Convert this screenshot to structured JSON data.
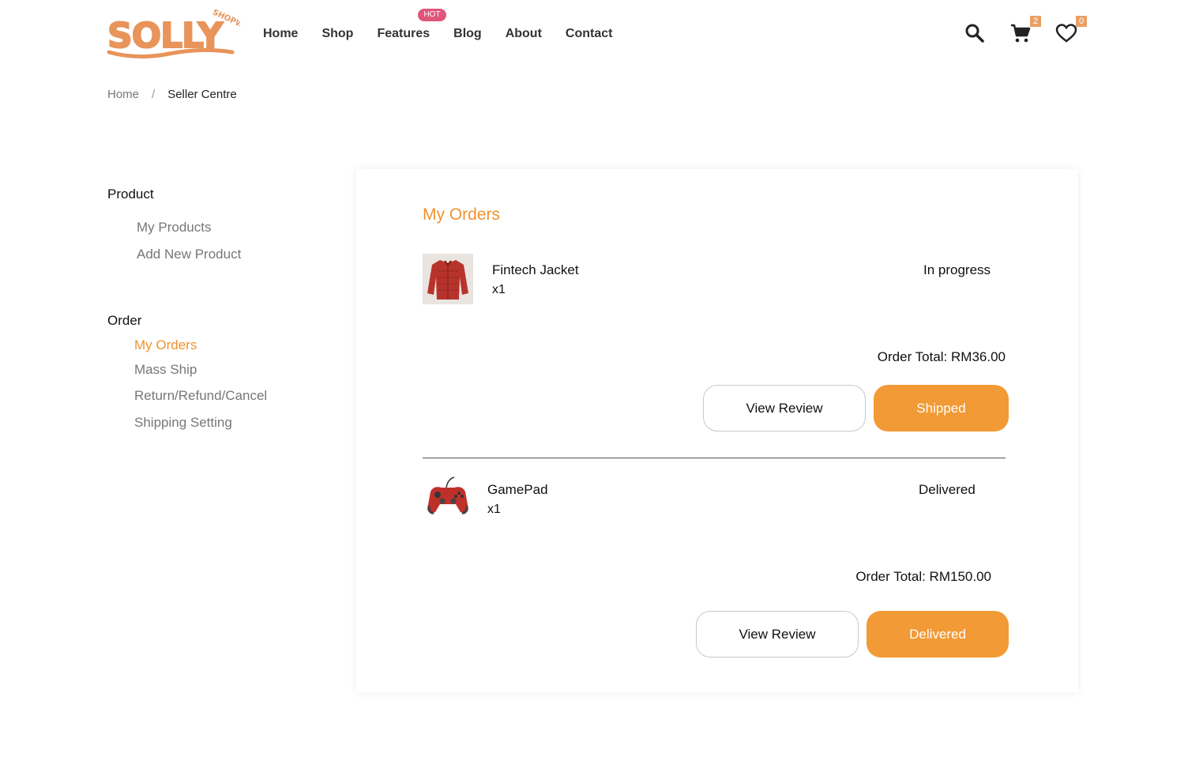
{
  "brand": {
    "name": "SOLLY",
    "tagline": "SHOPWE",
    "color": "#e8945a"
  },
  "nav": {
    "items": [
      "Home",
      "Shop",
      "Features",
      "Blog",
      "About",
      "Contact"
    ],
    "hot_badge": "HOT"
  },
  "header_icons": {
    "search": "search-icon",
    "cart": "cart-icon",
    "cart_count": "2",
    "wishlist": "heart-icon",
    "wishlist_count": "0"
  },
  "breadcrumb": {
    "home": "Home",
    "separator": "/",
    "current": "Seller Centre"
  },
  "sidebar": {
    "product_heading": "Product",
    "product_links": [
      "My Products",
      "Add New Product"
    ],
    "order_heading": "Order",
    "order_links": [
      "My Orders",
      "Mass Ship",
      "Return/Refund/Cancel",
      "Shipping Setting"
    ]
  },
  "main": {
    "title": "My Orders",
    "orders": [
      {
        "name": "Fintech Jacket",
        "qty": "x1",
        "status": "In progress",
        "total": "Order Total: RM36.00",
        "review_label": "View Review",
        "action_label": "Shipped"
      },
      {
        "name": "GamePad",
        "qty": "x1",
        "status": "Delivered",
        "total": "Order Total: RM150.00",
        "review_label": "View Review",
        "action_label": "Delivered"
      }
    ]
  },
  "colors": {
    "accent": "#f29a35",
    "hot": "#e0557a",
    "badge": "#e8a064"
  }
}
